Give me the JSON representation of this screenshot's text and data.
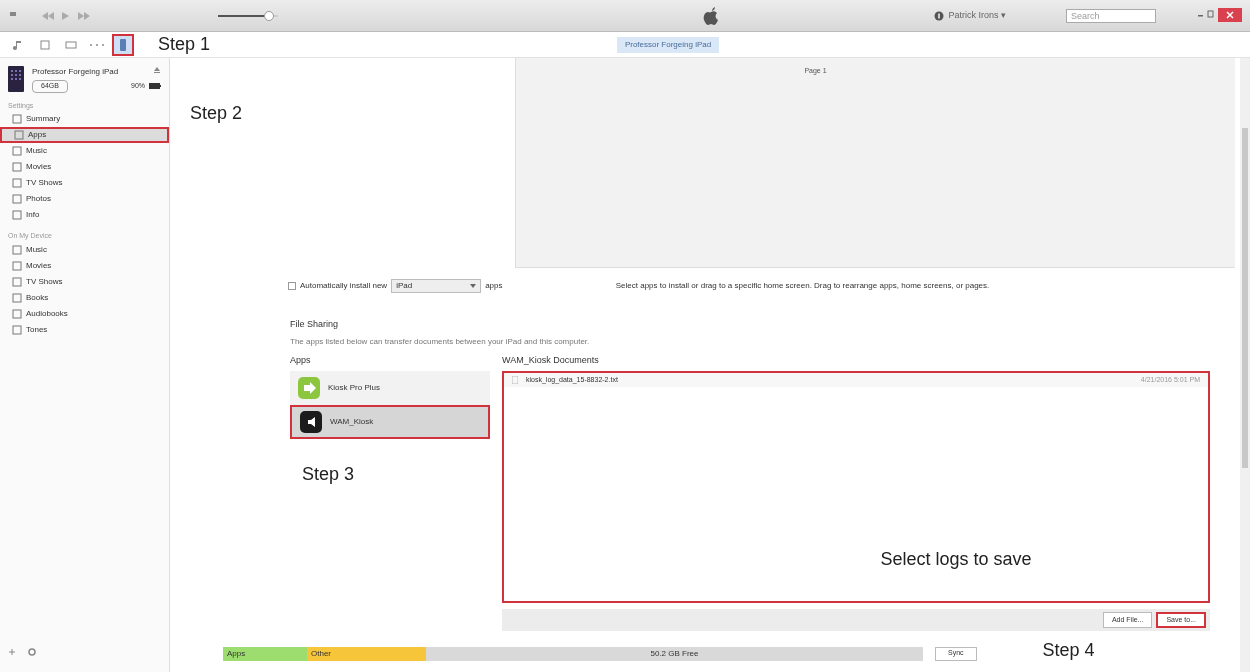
{
  "toolbar": {
    "volume": {
      "level": 0.85
    },
    "account": "Patrick Irons ▾",
    "search": {
      "placeholder": "Search"
    }
  },
  "nav": {
    "buttons": [
      {
        "kind": "music",
        "selected": false,
        "highlighted": false
      },
      {
        "kind": "movies",
        "selected": false,
        "highlighted": false
      },
      {
        "kind": "tv",
        "selected": false,
        "highlighted": false
      },
      {
        "kind": "more",
        "selected": false,
        "highlighted": false
      },
      {
        "kind": "device",
        "selected": true,
        "highlighted": true
      }
    ],
    "device_tab": "Professor Forgeing iPad"
  },
  "sidebar": {
    "device": {
      "name": "Professor Forgeing iPad",
      "capacity": "64GB",
      "battery": "90%"
    },
    "sections": [
      {
        "title": "Settings",
        "items": [
          {
            "label": "Summary",
            "selected": false,
            "highlighted": false
          },
          {
            "label": "Apps",
            "selected": true,
            "highlighted": true
          },
          {
            "label": "Music",
            "selected": false,
            "highlighted": false
          },
          {
            "label": "Movies",
            "selected": false,
            "highlighted": false
          },
          {
            "label": "TV Shows",
            "selected": false,
            "highlighted": false
          },
          {
            "label": "Photos",
            "selected": false,
            "highlighted": false
          },
          {
            "label": "Info",
            "selected": false,
            "highlighted": false
          }
        ]
      },
      {
        "title": "On My Device",
        "items": [
          {
            "label": "Music",
            "selected": false,
            "highlighted": false
          },
          {
            "label": "Movies",
            "selected": false,
            "highlighted": false
          },
          {
            "label": "TV Shows",
            "selected": false,
            "highlighted": false
          },
          {
            "label": "Books",
            "selected": false,
            "highlighted": false
          },
          {
            "label": "Audiobooks",
            "selected": false,
            "highlighted": false
          },
          {
            "label": "Tones",
            "selected": false,
            "highlighted": false
          }
        ]
      }
    ]
  },
  "home_screens": {
    "page_label": "Page 1"
  },
  "auto_install": {
    "checked": false,
    "before": "Automatically install new",
    "select": "iPad",
    "after": "apps"
  },
  "hint": "Select apps to install or drag to a specific home screen. Drag to rearrange apps, home screens, or pages.",
  "file_sharing": {
    "title": "File Sharing",
    "description": "The apps listed below can transfer documents between your iPad and this computer.",
    "apps_heading": "Apps",
    "apps": [
      {
        "name": "Kiosk Pro Plus",
        "selected": false,
        "highlighted": false
      },
      {
        "name": "WAM_Kiosk",
        "selected": true,
        "highlighted": true
      }
    ],
    "documents_heading": "WAM_Kiosk Documents",
    "documents_highlighted": true,
    "documents": [
      {
        "name": "kiosk_log_data_15-8832-2.txt",
        "date": "4/21/2016 5:01 PM"
      }
    ],
    "buttons": [
      "Add File...",
      "Save to..."
    ],
    "save_highlighted": true
  },
  "capacity": {
    "segments": [
      {
        "label": "Apps",
        "color": "#9ddc6e"
      },
      {
        "label": "Other",
        "color": "#f7c53a"
      },
      {
        "label": "50.2 GB Free",
        "color": "#d9d9d9"
      }
    ],
    "sync": "Sync"
  },
  "annotations": {
    "step1": "Step 1",
    "step2": "Step 2",
    "step3": "Step 3",
    "step4": "Step 4",
    "logs": "Select logs to save"
  }
}
